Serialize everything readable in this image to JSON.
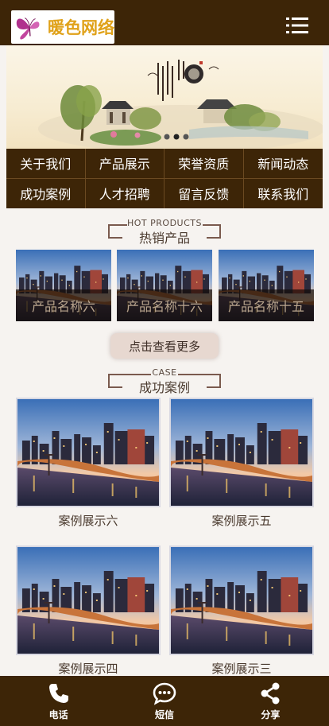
{
  "header": {
    "logo_text": "暖色网络",
    "menu_icon": "hamburger-menu-icon",
    "colors": {
      "bar": "#3d2507",
      "logo_text": "#e0a21a",
      "logo_butterfly": "#b0318d"
    }
  },
  "banner": {
    "indicator_count": 3,
    "active_indicator": 1
  },
  "nav": {
    "items": [
      {
        "label": "关于我们"
      },
      {
        "label": "产品展示"
      },
      {
        "label": "荣誉资质"
      },
      {
        "label": "新闻动态"
      },
      {
        "label": "成功案例"
      },
      {
        "label": "人才招聘"
      },
      {
        "label": "留言反馈"
      },
      {
        "label": "联系我们"
      }
    ]
  },
  "products_section": {
    "title_en": "HOT PRODUCTS",
    "title_cn": "热销产品",
    "items": [
      {
        "caption": "产品名称六"
      },
      {
        "caption": "产品名称十六"
      },
      {
        "caption": "产品名称十五"
      }
    ],
    "more_label": "点击查看更多"
  },
  "cases_section": {
    "title_en": "CASE",
    "title_cn": "成功案例",
    "items": [
      {
        "caption": "案例展示六"
      },
      {
        "caption": "案例展示五"
      },
      {
        "caption": "案例展示四"
      },
      {
        "caption": "案例展示三"
      }
    ]
  },
  "footer": {
    "items": [
      {
        "label": "电话",
        "icon": "phone-icon"
      },
      {
        "label": "短信",
        "icon": "sms-icon"
      },
      {
        "label": "分享",
        "icon": "share-icon"
      }
    ]
  }
}
